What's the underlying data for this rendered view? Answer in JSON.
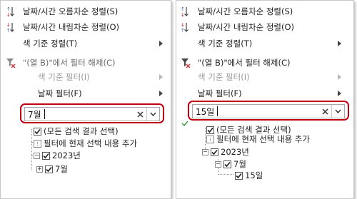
{
  "left_panel": {
    "menu": {
      "sort_asc": "날짜/시간 오름차순 정렬(S)",
      "sort_desc": "날짜/시간 내림차순 정렬(O)",
      "sort_by_color": "색 기준 정렬(T)",
      "clear_filter": "\"(열 B)\"에서 필터 해제(C)",
      "filter_by_color": "색 기준 필터(I)",
      "date_filter": "날짜 필터(F)"
    },
    "search": {
      "value": "7월",
      "placeholder": ""
    },
    "tree": {
      "select_all": "(모든 검색 결과 선택)",
      "add_to_filter": "필터에 현재 선택 내용 추가",
      "year": "2023년",
      "month": "7월"
    }
  },
  "right_panel": {
    "menu": {
      "sort_asc": "날짜/시간 오름차순 정렬(S)",
      "sort_desc": "날짜/시간 내림차순 정렬(O)",
      "sort_by_color": "색 기준 정렬(T)",
      "clear_filter": "\"(열 B)\"에서 필터 해제(C)",
      "filter_by_color": "색 기준 필터(I)",
      "date_filter": "날짜 필터(F)"
    },
    "search": {
      "value": "15일",
      "placeholder": ""
    },
    "tree": {
      "select_all": "(모든 검색 결과 선택)",
      "add_to_filter": "필터에 현재 선택 내용 추가",
      "year": "2023년",
      "month": "7월",
      "day": "15일"
    }
  },
  "colors": {
    "highlight_border": "#c0000f",
    "sort_icon_blue": "#2b5fb4",
    "clear_filter_red": "#d13438"
  },
  "icons": {
    "sort_asc": "sort-ascending-icon",
    "sort_desc": "sort-descending-icon",
    "clear_filter": "clear-filter-icon",
    "submenu": "chevron-right-icon",
    "clear_search": "clear-x-icon",
    "dropdown": "chevron-down-icon",
    "check": "check-icon"
  }
}
